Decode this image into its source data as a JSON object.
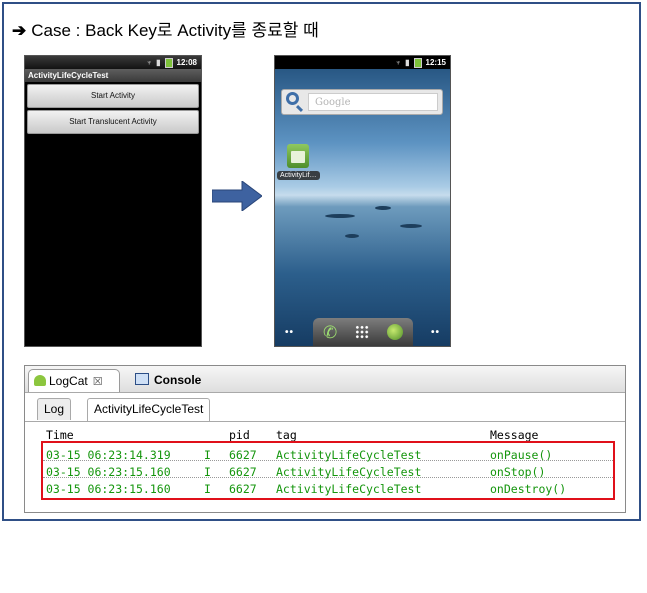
{
  "heading": {
    "arrow": "➔",
    "text": "Case : Back Key로 Activity를 종료할 때"
  },
  "phone1": {
    "time": "12:08",
    "title": "ActivityLifeCycleTest",
    "buttons": [
      "Start Activity",
      "Start Translucent Activity"
    ]
  },
  "phone2": {
    "time": "12:15",
    "search_placeholder": "Google",
    "app_label": "ActivityLif…",
    "dock_icons": [
      "phone-icon",
      "app-drawer-icon",
      "browser-icon"
    ]
  },
  "logcat": {
    "tabs": {
      "logcat": "LogCat",
      "console": "Console"
    },
    "sub_tabs": [
      "Log",
      "ActivityLifeCycleTest"
    ],
    "columns": {
      "time": "Time",
      "pid": "pid",
      "tag": "tag",
      "message": "Message"
    },
    "rows": [
      {
        "time": "03-15 06:23:14.319",
        "level": "I",
        "pid": "6627",
        "tag": "ActivityLifeCycleTest",
        "message": "onPause()"
      },
      {
        "time": "03-15 06:23:15.160",
        "level": "I",
        "pid": "6627",
        "tag": "ActivityLifeCycleTest",
        "message": "onStop()"
      },
      {
        "time": "03-15 06:23:15.160",
        "level": "I",
        "pid": "6627",
        "tag": "ActivityLifeCycleTest",
        "message": "onDestroy()"
      }
    ]
  },
  "colors": {
    "frame": "#2f4f86",
    "log_text": "#14950c",
    "highlight": "#e0101a",
    "arrow": "#3e62a0"
  }
}
